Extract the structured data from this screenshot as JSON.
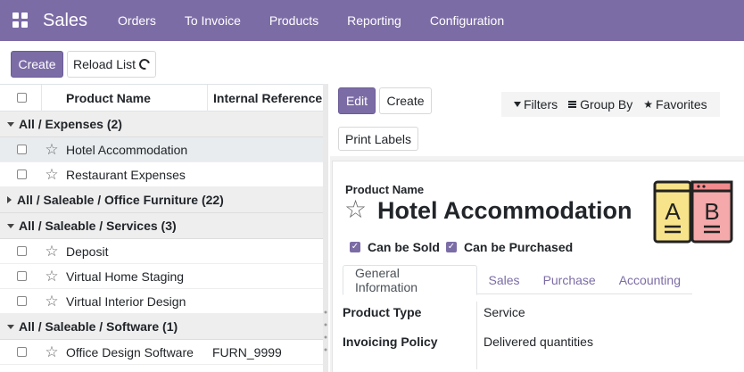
{
  "topbar": {
    "app_name": "Sales",
    "menu": [
      "Orders",
      "To Invoice",
      "Products",
      "Reporting",
      "Configuration"
    ],
    "background": "#7c6ca6"
  },
  "list_controls": {
    "create_label": "Create",
    "reload_label": "Reload List"
  },
  "list": {
    "columns": {
      "name": "Product Name",
      "reference": "Internal Reference"
    },
    "groups": [
      {
        "label": "All / Expenses (2)",
        "expanded": true,
        "rows": [
          {
            "name": "Hotel Accommodation",
            "reference": "",
            "selected": true
          },
          {
            "name": "Restaurant Expenses",
            "reference": "",
            "selected": false
          }
        ]
      },
      {
        "label": "All / Saleable / Office Furniture (22)",
        "expanded": false,
        "rows": []
      },
      {
        "label": "All / Saleable / Services (3)",
        "expanded": true,
        "rows": [
          {
            "name": "Deposit",
            "reference": "",
            "selected": false
          },
          {
            "name": "Virtual Home Staging",
            "reference": "",
            "selected": false
          },
          {
            "name": "Virtual Interior Design",
            "reference": "",
            "selected": false
          }
        ]
      },
      {
        "label": "All / Saleable / Software (1)",
        "expanded": true,
        "rows": [
          {
            "name": "Office Design Software",
            "reference": "FURN_9999",
            "selected": false
          }
        ]
      }
    ]
  },
  "form_controls": {
    "edit_label": "Edit",
    "create_label": "Create",
    "print_labels": "Print Labels",
    "filters": "Filters",
    "group_by": "Group By",
    "favorites": "Favorites"
  },
  "form": {
    "product_name_label": "Product Name",
    "product_name": "Hotel Accommodation",
    "can_be_sold_label": "Can be Sold",
    "can_be_purchased_label": "Can be Purchased",
    "can_be_sold": true,
    "can_be_purchased": true,
    "tabs": [
      "General Information",
      "Sales",
      "Purchase",
      "Accounting"
    ],
    "active_tab": "General Information",
    "fields": [
      {
        "label": "Product Type",
        "value": "Service"
      },
      {
        "label": "Invoicing Policy",
        "value": "Delivered quantities"
      }
    ],
    "image_letters": [
      "A",
      "B"
    ]
  }
}
